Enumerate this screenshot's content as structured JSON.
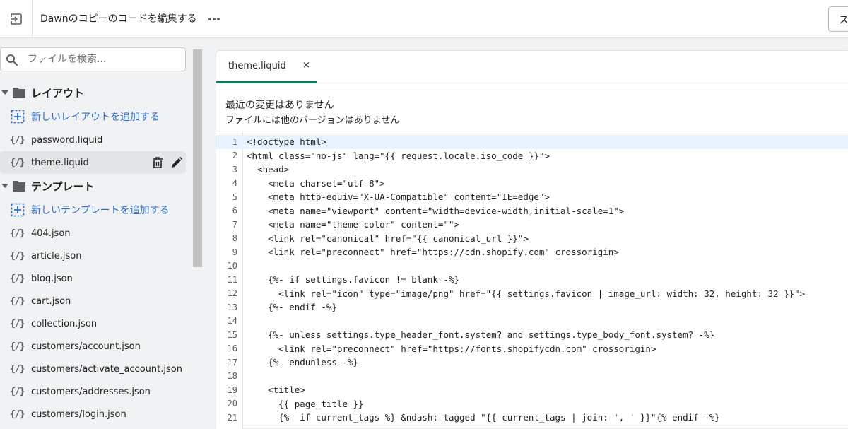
{
  "topbar": {
    "title": "Dawnのコピーのコードを編集する",
    "save_label": "ス"
  },
  "sidebar": {
    "search_placeholder": "ファイルを検索...",
    "layout_folder": "レイアウト",
    "add_layout": "新しいレイアウトを追加する",
    "layout_files": [
      "password.liquid",
      "theme.liquid"
    ],
    "template_folder": "テンプレート",
    "add_template": "新しいテンプレートを追加する",
    "template_files": [
      "404.json",
      "article.json",
      "blog.json",
      "cart.json",
      "collection.json",
      "customers/account.json",
      "customers/activate_account.json",
      "customers/addresses.json",
      "customers/login.json"
    ],
    "file_icon_text": "{/}"
  },
  "editor": {
    "tab_label": "theme.liquid",
    "tab_close": "×",
    "info_line1": "最近の変更はありません",
    "info_line2": "ファイルには他のバージョンはありません",
    "line_numbers": [
      "1",
      "2",
      "3",
      "4",
      "5",
      "6",
      "7",
      "8",
      "9",
      "10",
      "11",
      "12",
      "13",
      "14",
      "15",
      "16",
      "17",
      "18",
      "19",
      "20",
      "21"
    ],
    "code_lines": [
      "<!doctype html>",
      "<html class=\"no-js\" lang=\"{{ request.locale.iso_code }}\">",
      "  <head>",
      "    <meta charset=\"utf-8\">",
      "    <meta http-equiv=\"X-UA-Compatible\" content=\"IE=edge\">",
      "    <meta name=\"viewport\" content=\"width=device-width,initial-scale=1\">",
      "    <meta name=\"theme-color\" content=\"\">",
      "    <link rel=\"canonical\" href=\"{{ canonical_url }}\">",
      "    <link rel=\"preconnect\" href=\"https://cdn.shopify.com\" crossorigin>",
      "",
      "    {%- if settings.favicon != blank -%}",
      "      <link rel=\"icon\" type=\"image/png\" href=\"{{ settings.favicon | image_url: width: 32, height: 32 }}\">",
      "    {%- endif -%}",
      "",
      "    {%- unless settings.type_header_font.system? and settings.type_body_font.system? -%}",
      "      <link rel=\"preconnect\" href=\"https://fonts.shopifycdn.com\" crossorigin>",
      "    {%- endunless -%}",
      "",
      "    <title>",
      "      {{ page_title }}",
      "      {%- if current_tags %} &ndash; tagged \"{{ current_tags | join: ', ' }}\"{% endif -%}"
    ]
  }
}
